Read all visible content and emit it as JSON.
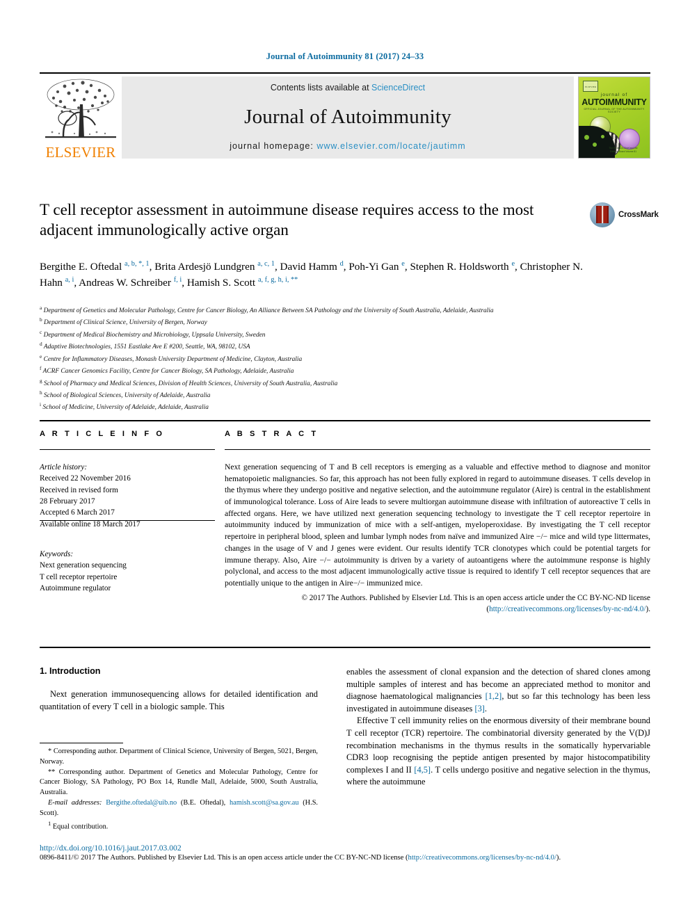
{
  "running_head": "Journal of Autoimmunity 81 (2017) 24–33",
  "header": {
    "publisher_logo_text": "ELSEVIER",
    "contents_prefix": "Contents lists available at ",
    "contents_link": "ScienceDirect",
    "journal_name": "Journal of Autoimmunity",
    "homepage_prefix": "journal homepage: ",
    "homepage_url": "www.elsevier.com/locate/jautimm",
    "cover": {
      "line1": "journal of",
      "line2": "AUTOIMMUNITY",
      "sub": "OFFICIAL JOURNAL OF THE AUTOIMMUNITY SOCIETY",
      "badge": "ELSEVIER",
      "caption": "The Editors-in-Chief\nand the Editorial Board\nVolume 81"
    },
    "crossmark_label": "CrossMark",
    "colors": {
      "link_blue": "#2a8fc4",
      "header_blue": "#0b6ba0",
      "elsevier_orange": "#f08000",
      "band_grey": "#e9e9e9",
      "cover_green": "#a9d128"
    }
  },
  "article": {
    "title": "T cell receptor assessment in autoimmune disease requires access to the most adjacent immunologically active organ",
    "authors": [
      {
        "name": "Bergithe E. Oftedal",
        "marks": "a, b, *, 1",
        "sep": ", "
      },
      {
        "name": "Brita Ardesjö Lundgren",
        "marks": "a, c, 1",
        "sep": ", "
      },
      {
        "name": "David Hamm",
        "marks": "d",
        "sep": ", "
      },
      {
        "name": "Poh-Yi Gan",
        "marks": "e",
        "sep": ", "
      },
      {
        "name": "Stephen R. Holdsworth",
        "marks": "e",
        "sep": ", "
      },
      {
        "name": "Christopher N. Hahn",
        "marks": "a, i",
        "sep": ", "
      },
      {
        "name": "Andreas W. Schreiber",
        "marks": "f, i",
        "sep": ", "
      },
      {
        "name": "Hamish S. Scott",
        "marks": "a, f, g, h, i, **",
        "sep": ""
      }
    ],
    "affiliations": [
      {
        "mark": "a",
        "text": "Department of Genetics and Molecular Pathology, Centre for Cancer Biology, An Alliance Between SA Pathology and the University of South Australia, Adelaide, Australia"
      },
      {
        "mark": "b",
        "text": "Department of Clinical Science, University of Bergen, Norway"
      },
      {
        "mark": "c",
        "text": "Department of Medical Biochemistry and Microbiology, Uppsala University, Sweden"
      },
      {
        "mark": "d",
        "text": "Adaptive Biotechnologies, 1551 Eastlake Ave E #200, Seattle, WA, 98102, USA"
      },
      {
        "mark": "e",
        "text": "Centre for Inflammatory Diseases, Monash University Department of Medicine, Clayton, Australia"
      },
      {
        "mark": "f",
        "text": "ACRF Cancer Genomics Facility, Centre for Cancer Biology, SA Pathology, Adelaide, Australia"
      },
      {
        "mark": "g",
        "text": "School of Pharmacy and Medical Sciences, Division of Health Sciences, University of South Australia, Australia"
      },
      {
        "mark": "h",
        "text": "School of Biological Sciences, University of Adelaide, Australia"
      },
      {
        "mark": "i",
        "text": "School of Medicine, University of Adelaide, Adelaide, Australia"
      }
    ]
  },
  "article_info": {
    "heading": "A R T I C L E   I N F O",
    "history_label": "Article history:",
    "history": [
      "Received 22 November 2016",
      "Received in revised form",
      "28 February 2017",
      "Accepted 6 March 2017",
      "Available online 18 March 2017"
    ],
    "keywords_label": "Keywords:",
    "keywords": [
      "Next generation sequencing",
      "T cell receptor repertoire",
      "Autoimmune regulator"
    ]
  },
  "abstract": {
    "heading": "A B S T R A C T",
    "text": "Next generation sequencing of T and B cell receptors is emerging as a valuable and effective method to diagnose and monitor hematopoietic malignancies. So far, this approach has not been fully explored in regard to autoimmune diseases. T cells develop in the thymus where they undergo positive and negative selection, and the autoimmune regulator (Aire) is central in the establishment of immunological tolerance. Loss of Aire leads to severe multiorgan autoimmune disease with infiltration of autoreactive T cells in affected organs. Here, we have utilized next generation sequencing technology to investigate the T cell receptor repertoire in autoimmunity induced by immunization of mice with a self-antigen, myeloperoxidase. By investigating the T cell receptor repertoire in peripheral blood, spleen and lumbar lymph nodes from naïve and immunized Aire −/− mice and wild type littermates, changes in the usage of V and J genes were evident. Our results identify TCR clonotypes which could be potential targets for immune therapy. Also, Aire −/− autoimmunity is driven by a variety of autoantigens where the autoimmune response is highly polyclonal, and access to the most adjacent immunologically active tissue is required to identify T cell receptor sequences that are potentially unique to the antigen in Aire−/− immunized mice.",
    "copyright_prefix": "© 2017 The Authors. Published by Elsevier Ltd. This is an open access article under the CC BY-NC-ND license (",
    "copyright_link": "http://creativecommons.org/licenses/by-nc-nd/4.0/",
    "copyright_suffix": ")."
  },
  "introduction": {
    "heading": "1. Introduction",
    "left_para1": "Next generation immunosequencing allows for detailed identification and quantitation of every T cell in a biologic sample. This",
    "right_para1_a": "enables the assessment of clonal expansion and the detection of shared clones among multiple samples of interest and has become an appreciated method to monitor and diagnose haematological malignancies ",
    "right_para1_ref1": "[1,2]",
    "right_para1_b": ", but so far this technology has been less investigated in autoimmune diseases ",
    "right_para1_ref2": "[3]",
    "right_para1_c": ".",
    "right_para2_a": "Effective T cell immunity relies on the enormous diversity of their membrane bound T cell receptor (TCR) repertoire. The combinatorial diversity generated by the V(D)J recombination mechanisms in the thymus results in the somatically hypervariable CDR3 loop recognising the peptide antigen presented by major histocompatibility complexes I and II ",
    "right_para2_ref": "[4,5]",
    "right_para2_b": ". T cells undergo positive and negative selection in the thymus, where the autoimmune"
  },
  "footnotes": {
    "corr1_mark": "*",
    "corr1": " Corresponding author. Department of Clinical Science, University of Bergen, 5021, Bergen, Norway.",
    "corr2_mark": "**",
    "corr2": " Corresponding author. Department of Genetics and Molecular Pathology, Centre for Cancer Biology, SA Pathology, PO Box 14, Rundle Mall, Adelaide, 5000, South Australia, Australia.",
    "email_label": "E-mail addresses:",
    "email1": "Bergithe.oftedal@uib.no",
    "email1_owner": " (B.E. Oftedal), ",
    "email2": "hamish.scott@sa.gov.au",
    "email2_owner": " (H.S. Scott).",
    "equal_mark": "1",
    "equal": " Equal contribution."
  },
  "footer": {
    "doi": "http://dx.doi.org/10.1016/j.jaut.2017.03.002",
    "issn_prefix": "0896-8411/© 2017 The Authors. Published by Elsevier Ltd. This is an open access article under the CC BY-NC-ND license (",
    "issn_link": "http://creativecommons.org/licenses/by-nc-nd/4.0/",
    "issn_suffix": ")."
  }
}
